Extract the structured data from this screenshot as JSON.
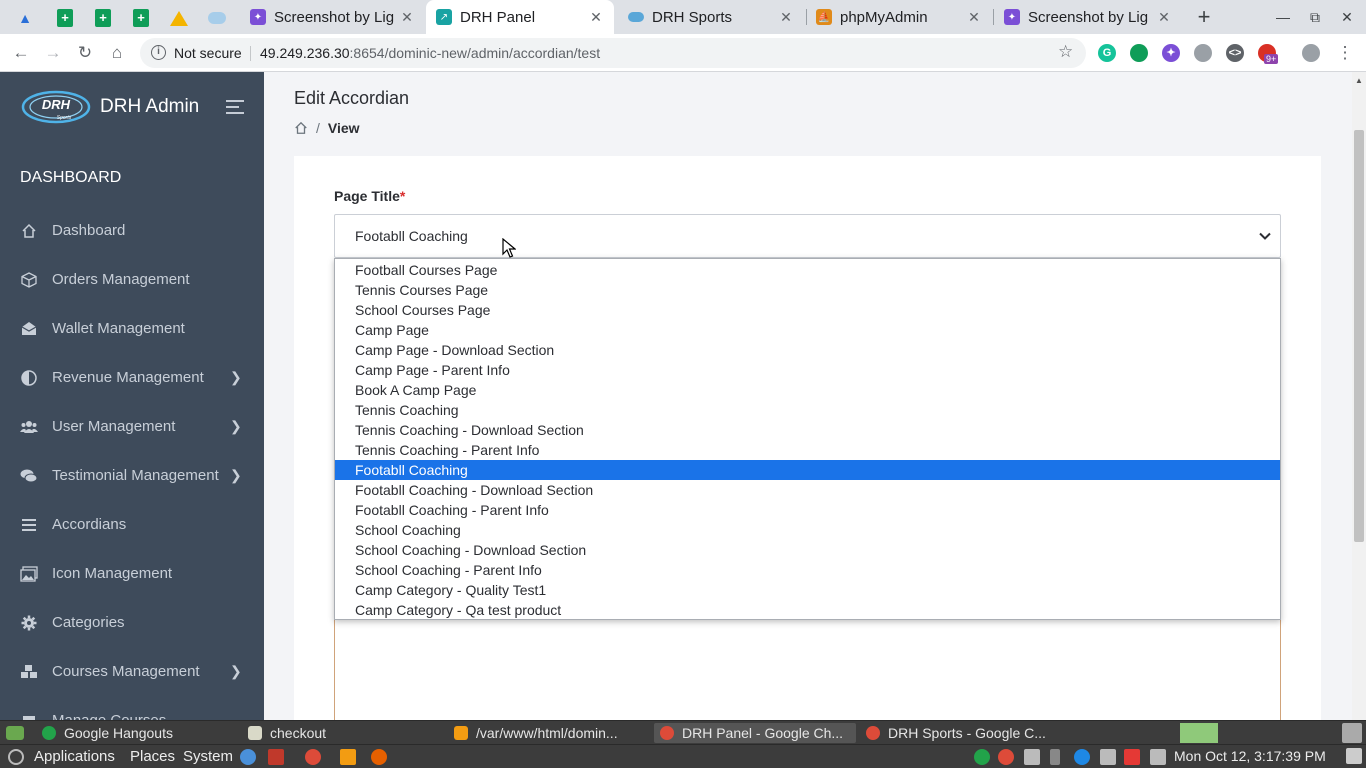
{
  "browser": {
    "tabs": [
      {
        "title": "Screenshot by Lig",
        "favicon": "feather-icon",
        "color": "#7b4fd6"
      },
      {
        "title": "DRH Panel",
        "favicon": "chart-icon",
        "color": "#19a3a3"
      },
      {
        "title": "DRH Sports",
        "favicon": "cloud-icon",
        "color": "#5aa7d8"
      },
      {
        "title": "phpMyAdmin",
        "favicon": "sail-icon",
        "color": "#e08a1a"
      },
      {
        "title": "Screenshot by Lig",
        "favicon": "feather-icon",
        "color": "#7b4fd6"
      }
    ],
    "address": {
      "security_label": "Not secure",
      "host": "49.249.236.30",
      "path": ":8654/dominic-new/admin/accordian/test"
    },
    "extension_badge": "9+"
  },
  "sidebar": {
    "brand": "DRH Admin",
    "logo_text": "DRH",
    "logo_subtext": "Sports",
    "section_heading": "DASHBOARD",
    "items": [
      {
        "label": "Dashboard",
        "icon": "home-icon",
        "has_submenu": false
      },
      {
        "label": "Orders Management",
        "icon": "box-icon",
        "has_submenu": false
      },
      {
        "label": "Wallet Management",
        "icon": "envelope-icon",
        "has_submenu": false
      },
      {
        "label": "Revenue Management",
        "icon": "half-circle-icon",
        "has_submenu": true
      },
      {
        "label": "User Management",
        "icon": "users-icon",
        "has_submenu": true
      },
      {
        "label": "Testimonial Management",
        "icon": "comments-icon",
        "has_submenu": true
      },
      {
        "label": "Accordians",
        "icon": "list-icon",
        "has_submenu": false
      },
      {
        "label": "Icon Management",
        "icon": "image-icon",
        "has_submenu": false
      },
      {
        "label": "Categories",
        "icon": "gear-icon",
        "has_submenu": false
      },
      {
        "label": "Courses Management",
        "icon": "cubes-icon",
        "has_submenu": true
      },
      {
        "label": "Manage Courses",
        "icon": "cube-icon",
        "has_submenu": false
      }
    ]
  },
  "main": {
    "page_title": "Edit Accordian",
    "breadcrumb_current": "View",
    "field_label": "Page Title",
    "required_mark": "*",
    "selected_value": "Footabll Coaching"
  },
  "dropdown": {
    "options": [
      "Football Courses Page",
      "Tennis Courses Page",
      "School Courses Page",
      "Camp Page",
      "Camp Page - Download Section",
      "Camp Page - Parent Info",
      "Book A Camp Page",
      "Tennis Coaching",
      "Tennis Coaching - Download Section",
      "Tennis Coaching - Parent Info",
      "Footabll Coaching",
      "Footabll Coaching - Download Section",
      "Footabll Coaching - Parent Info",
      "School Coaching",
      "School Coaching - Download Section",
      "School Coaching - Parent Info",
      "Camp Category - Quality Test1",
      "Camp Category - Qa test product"
    ],
    "selected_index": 10,
    "highlight_color": "#1a73e8"
  },
  "taskbar": {
    "windows": [
      {
        "title": "Google Hangouts",
        "color": "#22a34a"
      },
      {
        "title": "checkout",
        "color": "#d9d9c8"
      },
      {
        "title": "/var/www/html/domin...",
        "color": "#f39c12"
      },
      {
        "title": "DRH Panel - Google Ch...",
        "color": "#dd4b39"
      },
      {
        "title": "DRH Sports - Google C...",
        "color": "#dd4b39"
      }
    ],
    "menus": [
      "Applications",
      "Places",
      "System"
    ],
    "clock": "Mon Oct 12, 3:17:39 PM"
  },
  "colors": {
    "sidebar_bg": "#3e4b5b",
    "accent": "#1a73e8",
    "required": "#d92d2d"
  }
}
